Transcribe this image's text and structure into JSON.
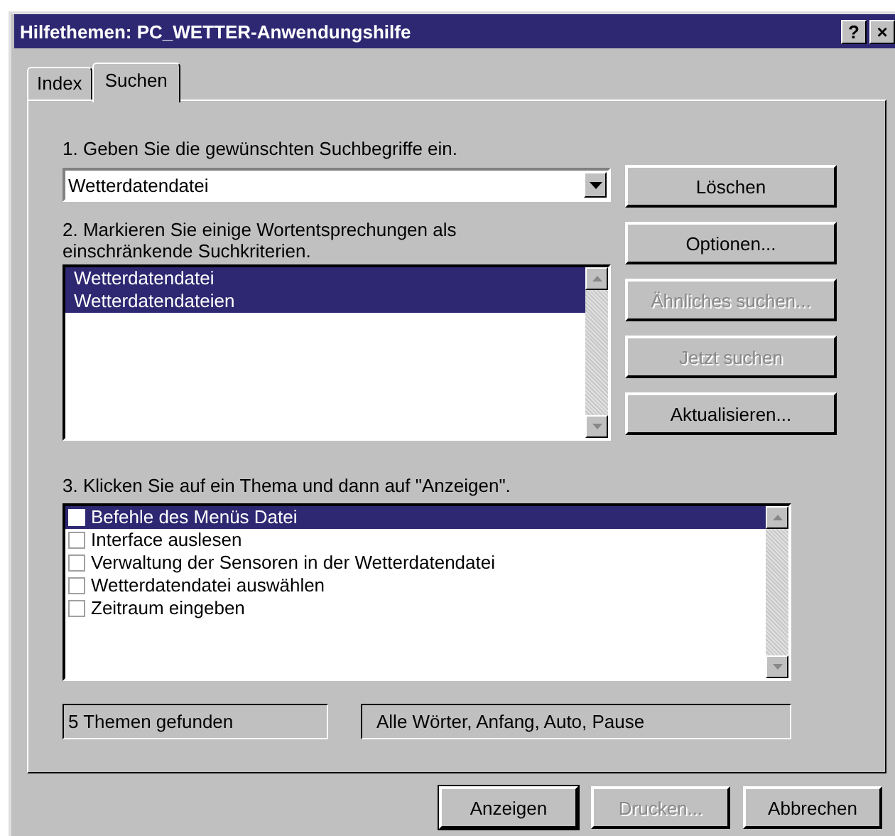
{
  "window": {
    "title": "Hilfethemen: PC_WETTER-Anwendungshilfe",
    "title_buttons": [
      "?",
      "×"
    ]
  },
  "tabs": [
    {
      "label": "Index",
      "selected": false
    },
    {
      "label": "Suchen",
      "selected": true
    }
  ],
  "step1": {
    "label": "1. Geben Sie die gewünschten Suchbegriffe ein.",
    "value": "Wetterdatendatei"
  },
  "step2": {
    "label": "2. Markieren Sie einige Wortentsprechungen als einschränkende Suchkriterien.",
    "words": [
      {
        "label": "Wetterdatendatei",
        "selected": true
      },
      {
        "label": "Wetterdatendateien",
        "selected": true
      }
    ]
  },
  "side_buttons": [
    {
      "label": "Löschen",
      "disabled": false
    },
    {
      "label": "Optionen...",
      "disabled": false
    },
    {
      "label": "Ähnliches suchen...",
      "disabled": true
    },
    {
      "label": "Jetzt suchen",
      "disabled": true
    },
    {
      "label": "Aktualisieren...",
      "disabled": false
    }
  ],
  "step3": {
    "label": "3. Klicken Sie auf ein Thema und dann auf \"Anzeigen\".",
    "topics": [
      {
        "label": "Befehle des Menüs Datei",
        "selected": true,
        "checked": false
      },
      {
        "label": "Interface auslesen",
        "selected": false,
        "checked": false
      },
      {
        "label": "Verwaltung der Sensoren in der Wetterdatendatei",
        "selected": false,
        "checked": false
      },
      {
        "label": "Wetterdatendatei auswählen",
        "selected": false,
        "checked": false
      },
      {
        "label": "Zeitraum eingeben",
        "selected": false,
        "checked": false
      }
    ]
  },
  "status": {
    "found": "5 Themen gefunden",
    "options": "Alle Wörter, Anfang, Auto, Pause"
  },
  "bottom_buttons": [
    {
      "label": "Anzeigen",
      "disabled": false,
      "default": true
    },
    {
      "label": "Drucken...",
      "disabled": true,
      "default": false
    },
    {
      "label": "Abbrechen",
      "disabled": false,
      "default": false
    }
  ]
}
